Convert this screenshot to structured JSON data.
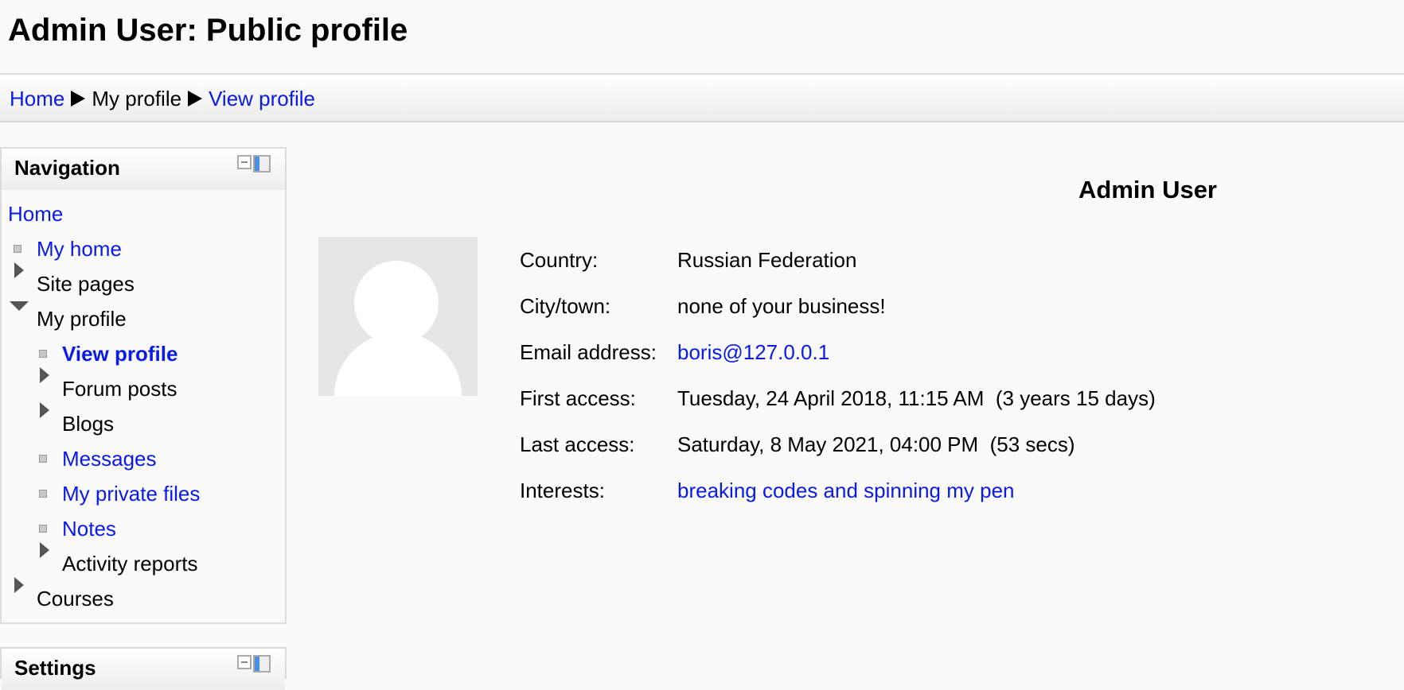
{
  "page": {
    "title": "Admin User: Public profile"
  },
  "breadcrumb": {
    "items": [
      {
        "label": "Home",
        "link": true
      },
      {
        "label": "My profile",
        "link": false
      },
      {
        "label": "View profile",
        "link": true
      }
    ]
  },
  "navigation": {
    "title": "Navigation",
    "items": [
      {
        "label": "Home",
        "link": true,
        "icon": "none"
      },
      {
        "label": "My home",
        "link": true,
        "icon": "bullet"
      },
      {
        "label": "Site pages",
        "link": false,
        "icon": "expand-arrow"
      },
      {
        "label": "My profile",
        "link": false,
        "icon": "collapse-arrow"
      },
      {
        "label": "View profile",
        "link": true,
        "icon": "bullet",
        "current": true
      },
      {
        "label": "Forum posts",
        "link": false,
        "icon": "expand-arrow"
      },
      {
        "label": "Blogs",
        "link": false,
        "icon": "expand-arrow"
      },
      {
        "label": "Messages",
        "link": true,
        "icon": "bullet"
      },
      {
        "label": "My private files",
        "link": true,
        "icon": "bullet"
      },
      {
        "label": "Notes",
        "link": true,
        "icon": "bullet"
      },
      {
        "label": "Activity reports",
        "link": false,
        "icon": "expand-arrow"
      },
      {
        "label": "Courses",
        "link": false,
        "icon": "expand-arrow"
      }
    ]
  },
  "settings_block": {
    "title": "Settings"
  },
  "profile": {
    "name": "Admin User",
    "fields": [
      {
        "label": "Country:",
        "value": "Russian Federation",
        "link": false
      },
      {
        "label": "City/town:",
        "value": "none of your business!",
        "link": false
      },
      {
        "label": "Email address:",
        "value": "boris@127.0.0.1",
        "link": true
      },
      {
        "label": "First access:",
        "value": "Tuesday, 24 April 2018, 11:15 AM  (3 years 15 days)",
        "link": false
      },
      {
        "label": "Last access:",
        "value": "Saturday, 8 May 2021, 04:00 PM  (53 secs)",
        "link": false
      },
      {
        "label": "Interests:",
        "value": "breaking codes and spinning my pen",
        "link": true
      }
    ]
  },
  "colors": {
    "link": "#0a1ae8",
    "background": "#fafafa"
  }
}
